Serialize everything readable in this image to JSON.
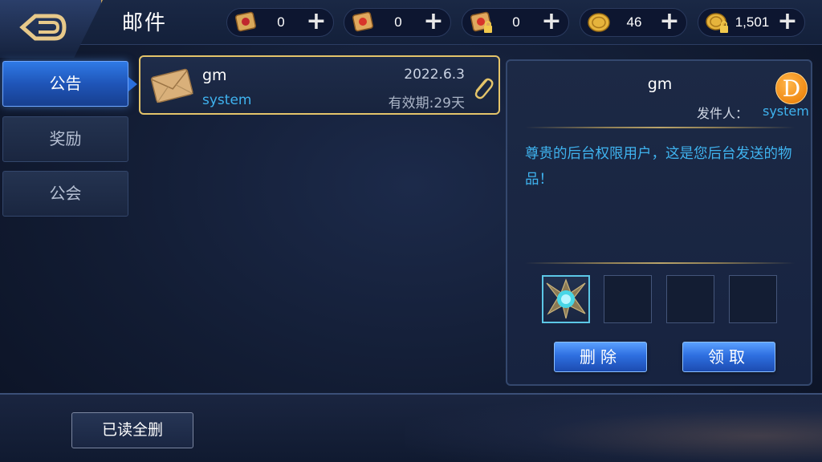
{
  "header": {
    "title": "邮件"
  },
  "currencies": [
    {
      "icon": "ticket-scroll-icon",
      "value": "0"
    },
    {
      "icon": "red-scroll-icon",
      "value": "0"
    },
    {
      "icon": "locked-scroll-icon",
      "value": "0"
    },
    {
      "icon": "gold-coin-icon",
      "value": "46"
    },
    {
      "icon": "locked-coin-icon",
      "value": "1,501"
    }
  ],
  "tabs": [
    {
      "label": "公告",
      "active": true
    },
    {
      "label": "奖励",
      "active": false
    },
    {
      "label": "公会",
      "active": false
    }
  ],
  "mail_list": [
    {
      "title": "gm",
      "sender": "system",
      "date": "2022.6.3",
      "expiry": "有效期:29天",
      "has_attachment": true
    }
  ],
  "detail": {
    "title": "gm",
    "avatar_letter": "D",
    "sender_label": "发件人：",
    "sender": "system",
    "body": "尊贵的后台权限用户，这是您后台发送的物品！",
    "attachments": [
      {
        "icon": "crystal-item-icon",
        "filled": true
      },
      {
        "filled": false
      },
      {
        "filled": false
      },
      {
        "filled": false
      }
    ],
    "delete_label": "删除",
    "claim_label": "领取"
  },
  "footer": {
    "delete_read_label": "已读全删"
  },
  "colors": {
    "accent_blue": "#3fb3ef",
    "selected_border": "#e4c46a",
    "button_blue": "#2e6fe0"
  }
}
